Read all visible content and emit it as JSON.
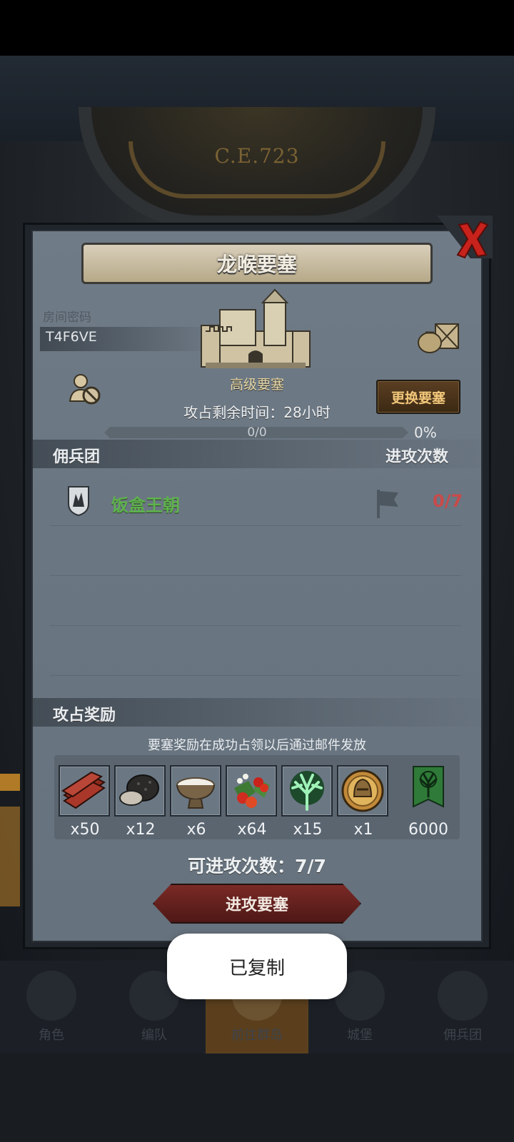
{
  "background": {
    "era_label": "C.E.723"
  },
  "nav": {
    "items": [
      {
        "label": "角色",
        "active": false
      },
      {
        "label": "编队",
        "active": false
      },
      {
        "label": "前往群岛",
        "active": true
      },
      {
        "label": "城堡",
        "active": false
      },
      {
        "label": "佣兵团",
        "active": false
      }
    ]
  },
  "dialog": {
    "title": "龙喉要塞",
    "room_label": "房间密码",
    "room_code": "T4F6VE",
    "fortress_grade": "高级要塞",
    "change_button": "更换要塞",
    "remaining_time": "攻占剩余时间：28小时",
    "progress": {
      "text": "0/0",
      "percent_text": "0%",
      "fraction": 0
    },
    "mercenary_header": "佣兵团",
    "attack_count_header": "进攻次数",
    "guild": {
      "name": "饭盒王朝",
      "attack_count": "0/7"
    },
    "reward_header": "攻占奖励",
    "reward_note": "要塞奖励在成功占领以后通过邮件发放",
    "rewards": [
      {
        "icon": "wood-planks-icon",
        "qty": "x50"
      },
      {
        "icon": "truffle-icon",
        "qty": "x12"
      },
      {
        "icon": "milk-bowl-icon",
        "qty": "x6"
      },
      {
        "icon": "berries-icon",
        "qty": "x64"
      },
      {
        "icon": "green-spirit-tree-icon",
        "qty": "x15"
      },
      {
        "icon": "knight-medal-icon",
        "qty": "x1"
      },
      {
        "icon": "tree-banner-icon",
        "qty": "6000"
      }
    ],
    "attempts": "可进攻次数：7/7",
    "attack_button": "进攻要塞"
  },
  "toast": {
    "text": "已复制"
  },
  "colors": {
    "guild_name": "#5fb24e",
    "attack_count": "#c84a4a",
    "change_button_text": "#f2c77a",
    "attack_button": "#7a2a26"
  }
}
